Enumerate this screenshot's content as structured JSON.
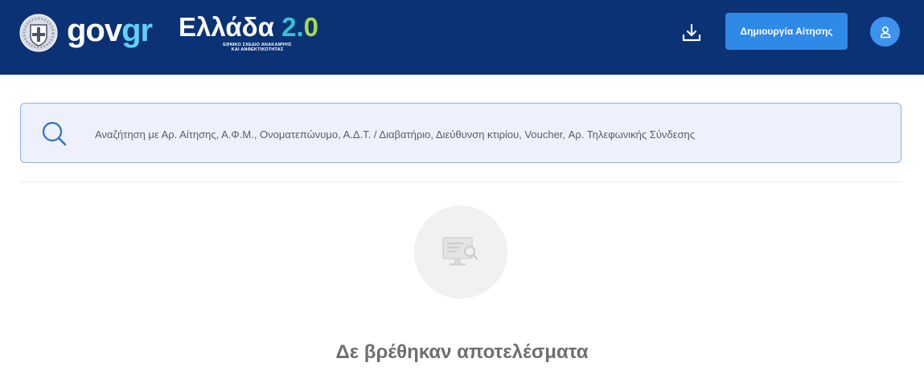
{
  "header": {
    "logo_gov": "gov",
    "logo_gr": "gr",
    "brand_title": "Ελλάδα",
    "brand_version_2": "2",
    "brand_version_dot": ".",
    "brand_version_0": "0",
    "brand_subtitle_line1": "ΕΘΝΙΚΟ ΣΧΕΔΙΟ ΑΝΑΚΑΜΨΗΣ",
    "brand_subtitle_line2": "ΚΑΙ ΑΝΘΕΚΤΙΚΟΤΗΤΑΣ",
    "create_button_label": "Δημιουργία Αίτησης",
    "download_icon": "download-icon",
    "user_icon": "user-icon",
    "background_color": "#0a3275",
    "accent_color": "#2f89e6"
  },
  "search": {
    "placeholder": "Αναζήτηση με Αρ. Αίτησης, Α.Φ.Μ., Ονοματεπώνυμο, Α.Δ.Τ. / Διαβατήριο, Διεύθυνση κτιρίου, Voucher, Αρ. Τηλεφωνικής Σύνδεσης",
    "value": "",
    "icon": "search-icon"
  },
  "empty_state": {
    "icon": "monitor-search-icon",
    "message": "Δε βρέθηκαν αποτελέσματα"
  }
}
